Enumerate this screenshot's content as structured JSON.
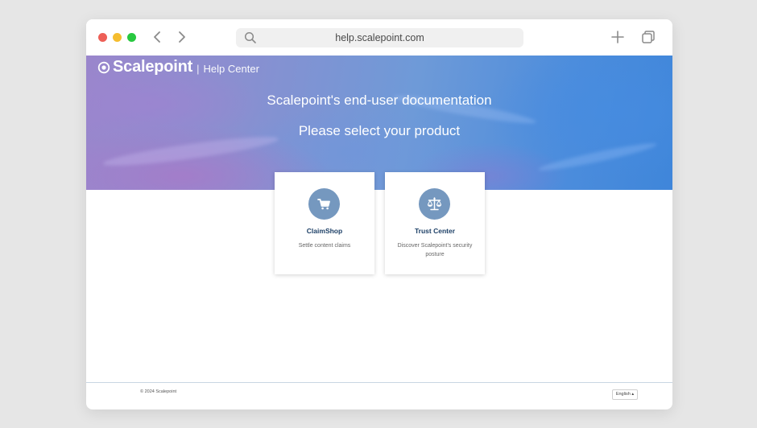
{
  "browser": {
    "url": "help.scalepoint.com"
  },
  "header": {
    "brand": "Scalepoint",
    "separator": "|",
    "section": "Help Center"
  },
  "hero": {
    "title": "Scalepoint's end-user documentation",
    "subtitle": "Please select your product"
  },
  "products": [
    {
      "title": "ClaimShop",
      "description": "Settle content claims",
      "icon": "shopping-cart-icon"
    },
    {
      "title": "Trust Center",
      "description": "Discover Scalepoint's security posture",
      "icon": "balance-scale-icon"
    }
  ],
  "footer": {
    "copyright": "© 2024 Scalepoint",
    "language": "English ▴"
  },
  "colors": {
    "card_icon_bg": "#7598bf",
    "card_title": "#1c3f66",
    "hero_start": "#9a86cc",
    "hero_end": "#3f86da"
  }
}
